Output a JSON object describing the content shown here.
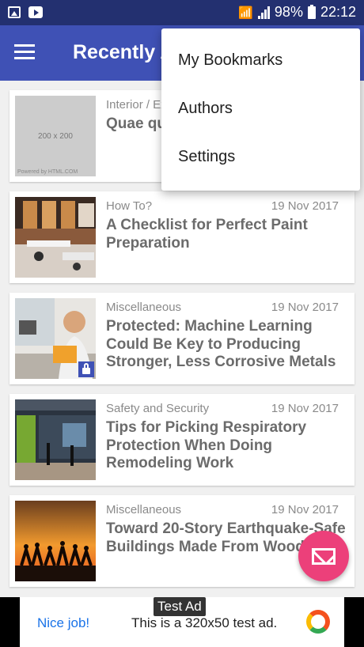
{
  "status_bar": {
    "left_icons": [
      "image-icon",
      "youtube-icon"
    ],
    "battery": "98%",
    "time": "22:12"
  },
  "app_bar": {
    "title": "Recently Added",
    "menu_icon": "hamburger-icon"
  },
  "menu": {
    "items": [
      {
        "label": "My Bookmarks"
      },
      {
        "label": "Authors"
      },
      {
        "label": "Settings"
      }
    ]
  },
  "posts": [
    {
      "category": "Interior / Exterior",
      "date": "",
      "title": "Quae quia...",
      "thumb_text": "200 x 200",
      "thumb_footer": "Powered by HTML.COM",
      "locked": false
    },
    {
      "category": "How To?",
      "date": "19 Nov 2017",
      "title": "A Checklist for Perfect Paint Preparation",
      "locked": false
    },
    {
      "category": "Miscellaneous",
      "date": "19 Nov 2017",
      "title": "Protected: Machine Learning Could Be Key to Producing Stronger, Less Corrosive Metals",
      "locked": true
    },
    {
      "category": "Safety and Security",
      "date": "19 Nov 2017",
      "title": "Tips for Picking Respiratory Protection When Doing Remodeling Work",
      "locked": false
    },
    {
      "category": "Miscellaneous",
      "date": "19 Nov 2017",
      "title": "Toward 20-Story Earthquake-Safe Buildings Made From Wood",
      "locked": false
    }
  ],
  "fab": {
    "icon": "envelope-icon"
  },
  "ad": {
    "label": "Test Ad",
    "nice": "Nice job!",
    "text": "This is a 320x50 test ad."
  },
  "colors": {
    "status_bar": "#233070",
    "primary": "#3f51b5",
    "accent": "#ec407a"
  }
}
